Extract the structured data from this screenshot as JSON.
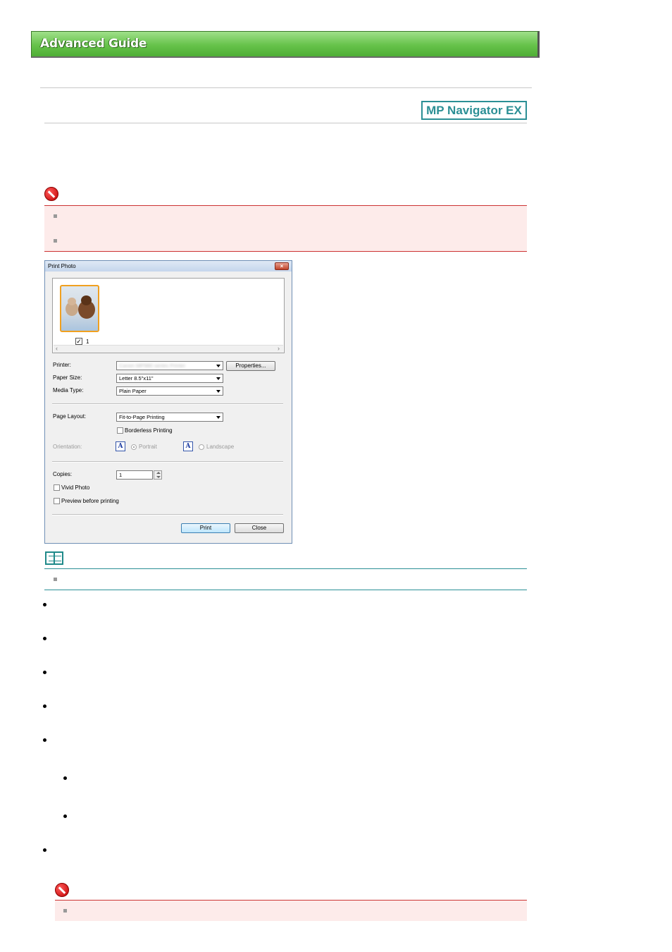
{
  "header": {
    "title": "Advanced Guide"
  },
  "badge": {
    "label": "MP Navigator EX"
  },
  "dialog": {
    "title": "Print Photo",
    "close_glyph": "×",
    "thumbnail": {
      "checked_glyph": "✓",
      "number": "1"
    },
    "scroll_left": "‹",
    "scroll_right": "›",
    "printer_label": "Printer:",
    "printer_value": "Canon MP980 series Printer",
    "properties_button": "Properties...",
    "paper_size_label": "Paper Size:",
    "paper_size_value": "Letter 8.5\"x11\"",
    "media_type_label": "Media Type:",
    "media_type_value": "Plain Paper",
    "page_layout_label": "Page Layout:",
    "page_layout_value": "Fit-to-Page Printing",
    "borderless_label": "Borderless Printing",
    "orientation_label": "Orientation:",
    "portrait_icon": "A",
    "portrait_label": "Portrait",
    "landscape_icon": "A",
    "landscape_label": "Landscape",
    "copies_label": "Copies:",
    "copies_value": "1",
    "vivid_label": "Vivid Photo",
    "preview_label": "Preview before printing",
    "print_button": "Print",
    "close_button": "Close"
  }
}
